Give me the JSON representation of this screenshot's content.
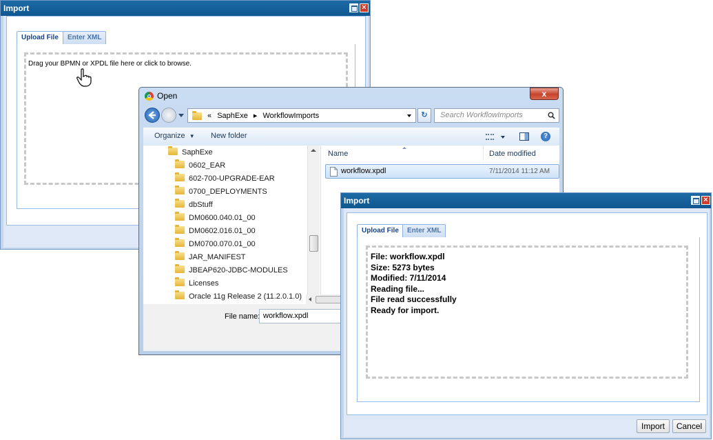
{
  "import_dialog_bg": {
    "title": "Import",
    "tabs": [
      {
        "label": "Upload File"
      },
      {
        "label": "Enter XML"
      }
    ],
    "dropzone_text": "Drag your BPMN or XPDL file here or click to browse."
  },
  "open_dialog": {
    "title": "Open",
    "close_glyph": "x",
    "breadcrumb": {
      "prefix": "«",
      "segments": [
        "SaphExe",
        "WorkflowImports"
      ],
      "separator": "▸"
    },
    "search_placeholder": "Search WorkflowImports",
    "toolbar": {
      "organize": "Organize",
      "new_folder": "New folder"
    },
    "folders": [
      "SaphExe",
      "0602_EAR",
      "602-700-UPGRADE-EAR",
      "0700_DEPLOYMENTS",
      "dbStuff",
      "DM0600.040.01_00",
      "DM0602.016.01_00",
      "DM0700.070.01_00",
      "JAR_MANIFEST",
      "JBEAP620-JDBC-MODULES",
      "Licenses",
      "Oracle 11g Release 2 (11.2.0.1.0)"
    ],
    "columns": {
      "name": "Name",
      "date_modified": "Date modified"
    },
    "files": [
      {
        "name": "workflow.xpdl",
        "date": "7/11/2014 11:12 AM"
      }
    ],
    "file_name_label": "File name:",
    "file_name_value": "workflow.xpdl"
  },
  "import_dialog_fg": {
    "title": "Import",
    "tabs": [
      {
        "label": "Upload File"
      },
      {
        "label": "Enter XML"
      }
    ],
    "status_lines": [
      "File: workflow.xpdl",
      "Size: 5273 bytes",
      "Modified: 7/11/2014",
      "Reading file...",
      "File read successfully",
      "Ready for import."
    ],
    "buttons": {
      "import": "Import",
      "cancel": "Cancel"
    }
  },
  "colors": {
    "title_bar": "#1560a0",
    "panel_bg": "#dfe8f6",
    "tab_text": "#15428b",
    "selected_row": "#dbeaf9"
  },
  "icons": [
    "maximize-icon",
    "close-icon",
    "hand-cursor-icon",
    "chrome-icon",
    "back-arrow-icon",
    "folder-icon",
    "file-icon",
    "search-icon",
    "help-icon",
    "views-icon",
    "preview-pane-icon",
    "refresh-icon"
  ]
}
